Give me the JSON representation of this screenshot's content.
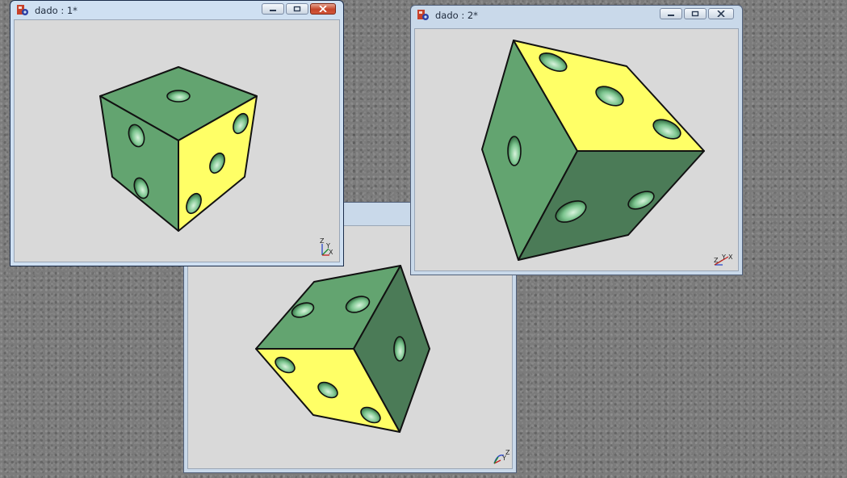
{
  "windows": [
    {
      "id": "win1",
      "title": "dado : 1*"
    },
    {
      "id": "win2",
      "title": "dado : 2*"
    },
    {
      "id": "win3",
      "title": ""
    }
  ],
  "colors": {
    "face_green": "#63a470",
    "face_dark_green": "#4b7b57",
    "face_yellow": "#ffff66",
    "viewport_bg": "#d9d9d9",
    "close_button_active": "#c4452a"
  },
  "icons": {
    "app": "gear-app-icon",
    "minimize": "minimize-icon",
    "maximize": "maximize-icon",
    "close": "close-icon",
    "axis": "axis-triad-icon"
  },
  "axes": {
    "win1": [
      "Z",
      "Y",
      "X"
    ],
    "win2": [
      "Z",
      "Y",
      "X"
    ],
    "win3": [
      "Y",
      "Z"
    ]
  }
}
